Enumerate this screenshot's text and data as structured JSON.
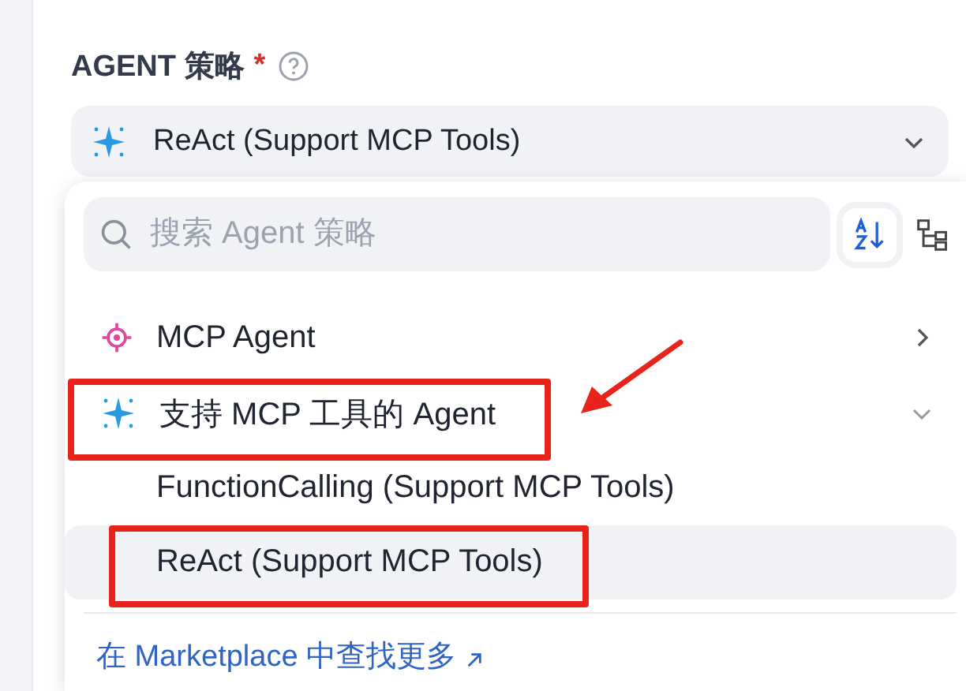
{
  "field": {
    "label": "AGENT 策略",
    "required_mark": "*",
    "value": "ReAct (Support MCP Tools)"
  },
  "dropdown": {
    "search": {
      "placeholder": "搜索 Agent 策略"
    },
    "providers": [
      {
        "name": "MCP Agent",
        "kind": "target",
        "expanded": false,
        "annotated": false
      },
      {
        "name": "支持 MCP 工具的 Agent",
        "kind": "sparkle",
        "expanded": true,
        "annotated": true,
        "children": [
          {
            "name": "FunctionCalling (Support MCP Tools)",
            "selected": false,
            "annotated": false
          },
          {
            "name": "ReAct (Support MCP Tools)",
            "selected": true,
            "annotated": true
          }
        ]
      }
    ],
    "footer_link": "在 Marketplace 中查找更多"
  }
}
